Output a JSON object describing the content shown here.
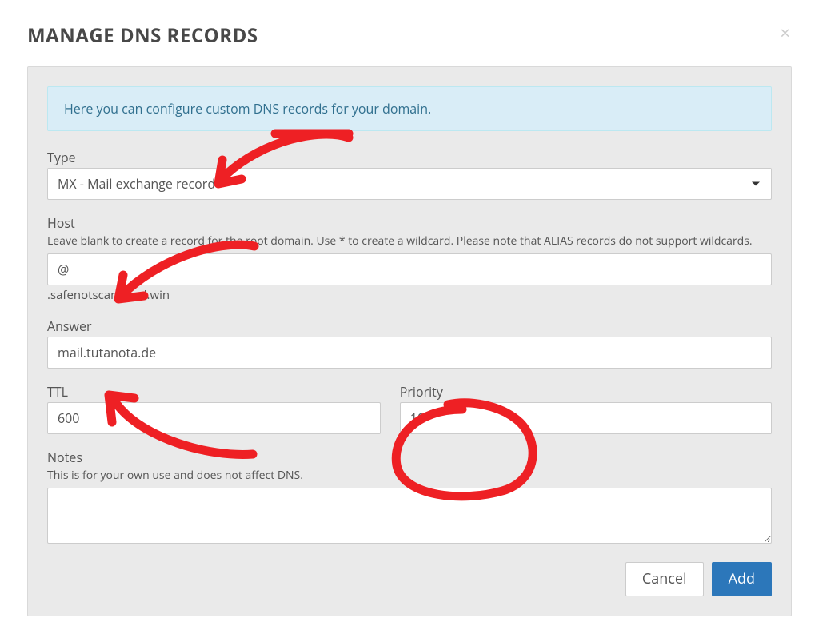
{
  "header": {
    "title": "MANAGE DNS RECORDS"
  },
  "info_banner": "Here you can configure custom DNS records for your domain.",
  "type": {
    "label": "Type",
    "selected": "MX - Mail exchange record"
  },
  "host": {
    "label": "Host",
    "help": "Leave blank to create a record for the root domain. Use * to create a wildcard. Please note that ALIAS records do not support wildcards.",
    "value": "@",
    "suffix": ".safenotscammed.win"
  },
  "answer": {
    "label": "Answer",
    "value": "mail.tutanota.de"
  },
  "ttl": {
    "label": "TTL",
    "value": "600"
  },
  "priority": {
    "label": "Priority",
    "value": "10"
  },
  "notes": {
    "label": "Notes",
    "help": "This is for your own use and does not affect DNS.",
    "value": ""
  },
  "footer": {
    "cancel": "Cancel",
    "add": "Add"
  },
  "annotations": {
    "color": "#ee2024"
  }
}
